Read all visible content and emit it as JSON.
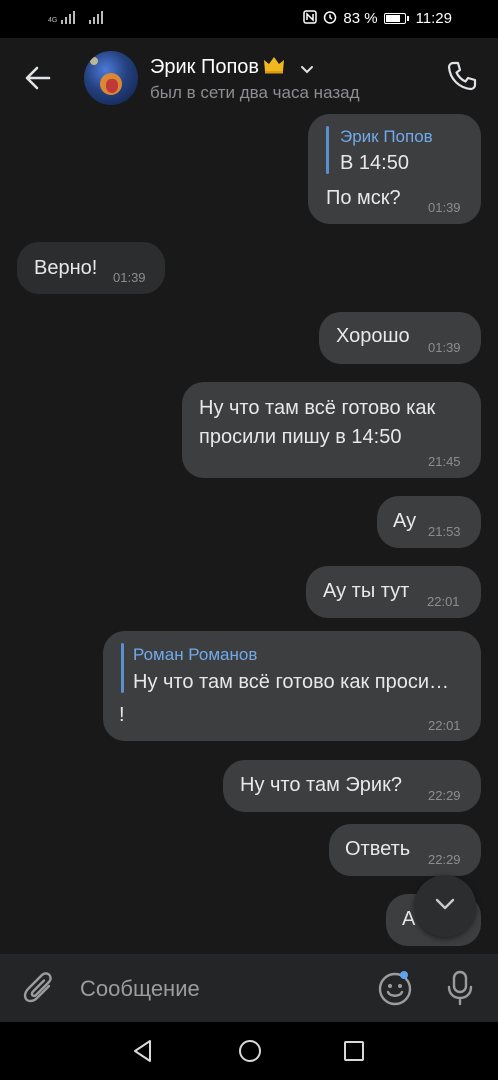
{
  "status_bar": {
    "network_label": "4G",
    "battery_percent": "83 %",
    "battery_level": 0.83,
    "time": "11:29",
    "icons": [
      "nfc-icon",
      "alarm-icon",
      "battery-icon"
    ]
  },
  "header": {
    "contact_name": "Эрик Попов",
    "status": "был в сети два часа назад",
    "icons": [
      "back-arrow-icon",
      "crown-icon",
      "chevron-down-icon",
      "phone-icon"
    ]
  },
  "messages": [
    {
      "direction": "out",
      "reply_name": "Эрик Попов",
      "reply_text": "В 14:50",
      "text": "По мск?",
      "time": "01:39"
    },
    {
      "direction": "in",
      "text": "Верно!",
      "time": "01:39"
    },
    {
      "direction": "out",
      "text": "Хорошо",
      "time": "01:39"
    },
    {
      "direction": "out",
      "text": "Ну что там всё готово как просили пишу в 14:50",
      "lines": [
        "Ну что там всё готово как",
        "просили пишу в 14:50"
      ],
      "time": "21:45"
    },
    {
      "direction": "out",
      "text": "Ау",
      "time": "21:53"
    },
    {
      "direction": "out",
      "text": "Ау ты тут",
      "time": "22:01"
    },
    {
      "direction": "out",
      "reply_name": "Роман Романов",
      "reply_text": "Ну что там всё готово как проси…",
      "text": "!",
      "time": "22:01"
    },
    {
      "direction": "out",
      "text": "Ну что там Эрик?",
      "time": "22:29"
    },
    {
      "direction": "out",
      "text": "Ответь",
      "time": "22:29"
    },
    {
      "direction": "out",
      "text": "А",
      "time": ""
    }
  ],
  "composer": {
    "placeholder": "Сообщение",
    "icons": [
      "attach-icon",
      "emoji-icon",
      "microphone-icon"
    ],
    "accent_color": "#5ea4f0"
  },
  "scroll_down": {
    "icon": "chevron-down-icon"
  },
  "navbar": {
    "icons": [
      "nav-back-icon",
      "nav-home-icon",
      "nav-recent-icon"
    ]
  },
  "colors": {
    "background": "#19191a",
    "outgoing_bubble": "#3d3e40",
    "incoming_bubble": "#2c2d2e",
    "reply_name": "#71aaeb"
  }
}
